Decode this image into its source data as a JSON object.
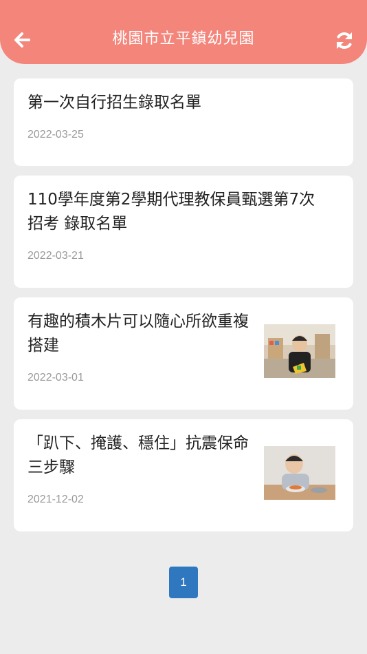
{
  "header": {
    "title": "桃園市立平鎮幼兒園",
    "back_icon": "arrow-left-icon",
    "refresh_icon": "refresh-icon",
    "background": "#f4857b"
  },
  "articles": [
    {
      "title": "第一次自行招生錄取名單",
      "date": "2022-03-25"
    },
    {
      "title": "110學年度第2學期代理教保員甄選第7次招考 錄取名單",
      "date": "2022-03-21"
    },
    {
      "title": "有趣的積木片可以隨心所欲重複搭建",
      "date": "2022-03-01"
    },
    {
      "title": "「趴下、掩護、穩住」抗震保命三步驟",
      "date": "2021-12-02"
    }
  ],
  "pagination": {
    "current": "1",
    "accent": "#2f78c0"
  }
}
